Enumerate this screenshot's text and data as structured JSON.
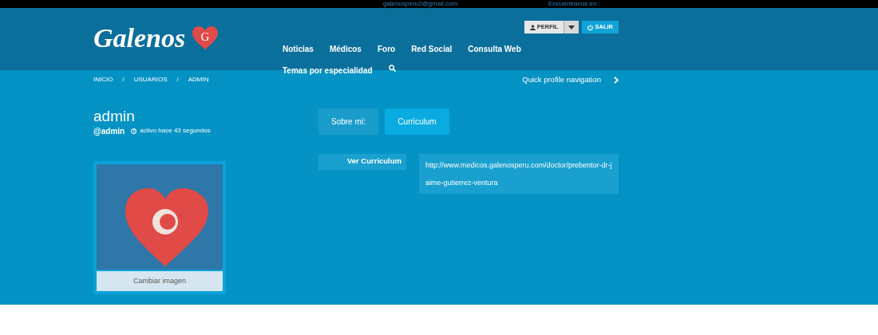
{
  "top_bar": {
    "email": "galenosperu2@gmail.com",
    "social_label": "Encuéntranos en :"
  },
  "header": {
    "logo": {
      "text": "Galenos",
      "badge": "G"
    },
    "user_buttons": {
      "profile": "PERFIL",
      "logout": "SALIR"
    },
    "nav": [
      {
        "label": "Noticias"
      },
      {
        "label": "Médicos"
      },
      {
        "label": "Foro"
      },
      {
        "label": "Red Social"
      },
      {
        "label": "Consulta Web"
      },
      {
        "label": "Temas por especialidad"
      }
    ]
  },
  "breadcrumb": {
    "items": [
      "INICIO",
      "USUARIOS",
      "ADMIN"
    ],
    "separator": "/",
    "quick_nav": "Quick profile navigation"
  },
  "profile": {
    "name": "admin",
    "handle": "@admin",
    "activity": "activo hace 43 segundos",
    "change_image": "Cambiar imagen"
  },
  "tabs": [
    {
      "label": "Sobre mí:",
      "selected": false
    },
    {
      "label": "Curriculum",
      "selected": true
    }
  ],
  "fields": [
    {
      "label": "Ver Curriculum",
      "value": "http://www.medicos.galenosperu.com/doctor/prebentor-dr-jaime-gutierrez-ventura"
    }
  ]
}
